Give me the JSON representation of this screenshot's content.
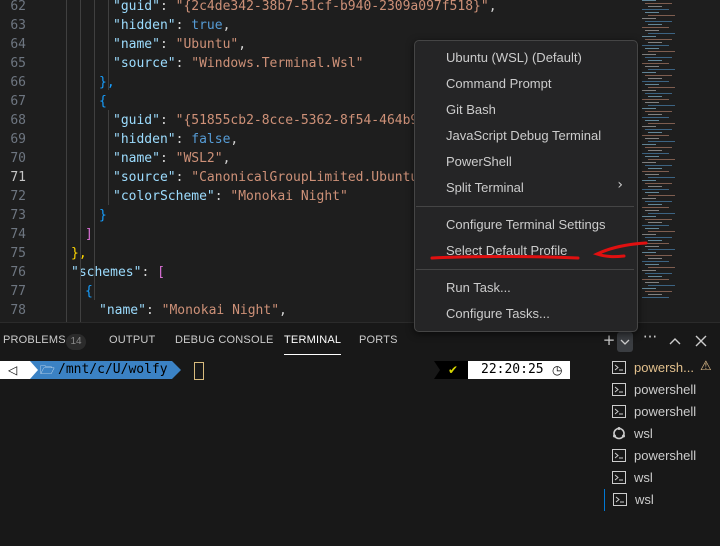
{
  "editor": {
    "lines": [
      {
        "n": "62",
        "tokens": [
          {
            "t": "\"guid\"",
            "c": "k"
          },
          {
            "t": ": ",
            "c": "p"
          },
          {
            "t": "\"{2c4de342-38b7-51cf-b940-2309a097f518}\"",
            "c": "s"
          },
          {
            "t": ",",
            "c": "p"
          }
        ]
      },
      {
        "n": "63",
        "tokens": [
          {
            "t": "\"hidden\"",
            "c": "k"
          },
          {
            "t": ": ",
            "c": "p"
          },
          {
            "t": "true",
            "c": "kw"
          },
          {
            "t": ",",
            "c": "p"
          }
        ]
      },
      {
        "n": "64",
        "tokens": [
          {
            "t": "\"name\"",
            "c": "k"
          },
          {
            "t": ": ",
            "c": "p"
          },
          {
            "t": "\"Ubuntu\"",
            "c": "s"
          },
          {
            "t": ",",
            "c": "p"
          }
        ]
      },
      {
        "n": "65",
        "tokens": [
          {
            "t": "\"source\"",
            "c": "k"
          },
          {
            "t": ": ",
            "c": "p"
          },
          {
            "t": "\"Windows.Terminal.Wsl\"",
            "c": "s"
          }
        ]
      },
      {
        "n": "66",
        "tokens": [
          {
            "t": "},",
            "c": "b3"
          }
        ]
      },
      {
        "n": "67",
        "tokens": [
          {
            "t": "{",
            "c": "b3"
          }
        ]
      },
      {
        "n": "68",
        "tokens": [
          {
            "t": "\"guid\"",
            "c": "k"
          },
          {
            "t": ": ",
            "c": "p"
          },
          {
            "t": "\"{51855cb2-8cce-5362-8f54-464b92",
            "c": "s"
          }
        ]
      },
      {
        "n": "69",
        "tokens": [
          {
            "t": "\"hidden\"",
            "c": "k"
          },
          {
            "t": ": ",
            "c": "p"
          },
          {
            "t": "false",
            "c": "kw"
          },
          {
            "t": ",",
            "c": "p"
          }
        ]
      },
      {
        "n": "70",
        "tokens": [
          {
            "t": "\"name\"",
            "c": "k"
          },
          {
            "t": ": ",
            "c": "p"
          },
          {
            "t": "\"WSL2\"",
            "c": "s"
          },
          {
            "t": ",",
            "c": "p"
          }
        ]
      },
      {
        "n": "71",
        "tokens": [
          {
            "t": "\"source\"",
            "c": "k"
          },
          {
            "t": ": ",
            "c": "p"
          },
          {
            "t": "\"CanonicalGroupLimited.Ubuntu_",
            "c": "s"
          }
        ]
      },
      {
        "n": "72",
        "tokens": [
          {
            "t": "\"colorScheme\"",
            "c": "k"
          },
          {
            "t": ": ",
            "c": "p"
          },
          {
            "t": "\"Monokai Night\"",
            "c": "s"
          }
        ]
      },
      {
        "n": "73",
        "tokens": [
          {
            "t": "}",
            "c": "b3"
          }
        ]
      },
      {
        "n": "74",
        "tokens": [
          {
            "t": "]",
            "c": "b2"
          }
        ]
      },
      {
        "n": "75",
        "tokens": [
          {
            "t": "},",
            "c": "b1"
          }
        ]
      },
      {
        "n": "76",
        "tokens": [
          {
            "t": "\"schemes\"",
            "c": "k"
          },
          {
            "t": ": ",
            "c": "p"
          },
          {
            "t": "[",
            "c": "b2"
          }
        ]
      },
      {
        "n": "77",
        "tokens": [
          {
            "t": "{",
            "c": "b3"
          }
        ]
      },
      {
        "n": "78",
        "tokens": [
          {
            "t": "\"name\"",
            "c": "k"
          },
          {
            "t": ": ",
            "c": "p"
          },
          {
            "t": "\"Monokai Night\"",
            "c": "s"
          },
          {
            "t": ",",
            "c": "p"
          }
        ]
      }
    ],
    "current_line": "71"
  },
  "panel": {
    "tabs": [
      {
        "label": "PROBLEMS"
      },
      {
        "label": "OUTPUT"
      },
      {
        "label": "DEBUG CONSOLE"
      },
      {
        "label": "TERMINAL"
      },
      {
        "label": "PORTS"
      }
    ],
    "problems_count": "14",
    "active_tab": "TERMINAL",
    "toolbar": {
      "new_terminal_icon": "plus-icon",
      "dropdown_icon": "chevron-down-icon",
      "more_icon": "ellipsis-icon",
      "maximize_icon": "chevron-up-icon",
      "close_icon": "close-icon"
    }
  },
  "terminal": {
    "os_glyph": "◁",
    "folder_glyph": "🗁",
    "path": "/mnt/c/U/wolfy",
    "status_check": "✔",
    "time": "22:20:25",
    "clock_glyph": "◷"
  },
  "terminal_list": [
    {
      "label": "powersh...",
      "icon": "terminal-icon",
      "warn": "⚠",
      "color": "#e2c08d"
    },
    {
      "label": "powershell",
      "icon": "terminal-icon"
    },
    {
      "label": "powershell",
      "icon": "terminal-icon"
    },
    {
      "label": "wsl",
      "icon": "linux-icon"
    },
    {
      "label": "powershell",
      "icon": "terminal-icon"
    },
    {
      "label": "wsl",
      "icon": "terminal-icon"
    },
    {
      "label": "wsl",
      "icon": "terminal-icon",
      "selected": true
    }
  ],
  "menu": {
    "group1": [
      "Ubuntu (WSL) (Default)",
      "Command Prompt",
      "Git Bash",
      "JavaScript Debug Terminal",
      "PowerShell",
      "Split Terminal"
    ],
    "group2": [
      "Configure Terminal Settings",
      "Select Default Profile"
    ],
    "group3": [
      "Run Task...",
      "Configure Tasks..."
    ],
    "submenu_arrow": "›"
  },
  "colors": {
    "annotation": "#e01010",
    "accent": "#0078d4",
    "warning": "#e2c08d"
  }
}
